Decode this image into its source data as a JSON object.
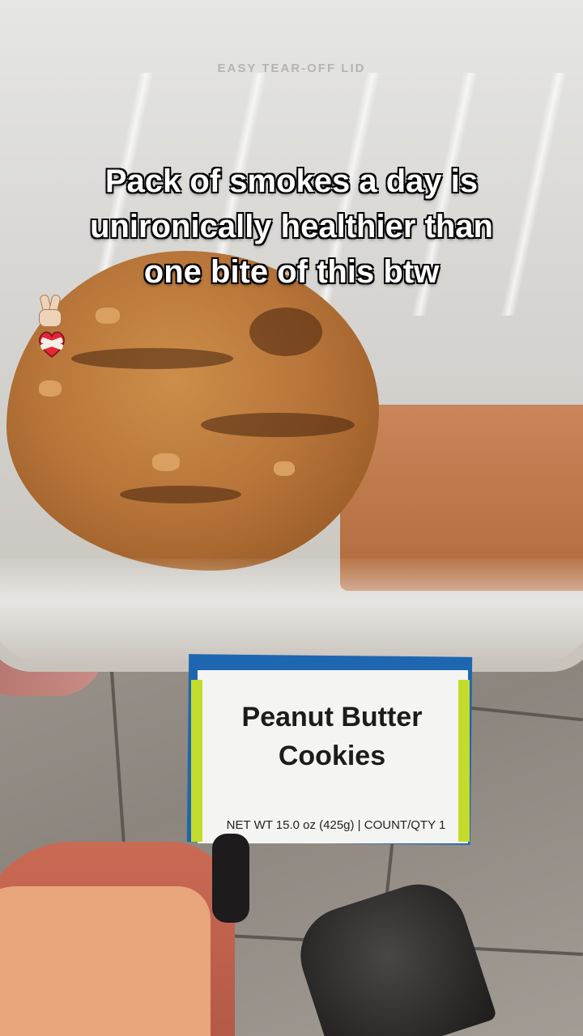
{
  "caption": {
    "line1": "Pack of smokes a day is",
    "line2": "unironically healthier than",
    "line3": "one bite of this btw",
    "emojis": [
      "victory-hand-emoji",
      "mending-heart-emoji"
    ]
  },
  "lid": {
    "embossed_text": "EASY TEAR-OFF LID"
  },
  "product_label": {
    "title_line1": "Peanut Butter",
    "title_line2": "Cookies",
    "net_weight": "NET WT 15.0 oz (425g) | COUNT/QTY 1"
  },
  "colors": {
    "label_blue": "#1f66b0",
    "label_green": "#c3dc2c",
    "cookie_brown": "#b8763a",
    "caption_text": "#ffffff"
  }
}
